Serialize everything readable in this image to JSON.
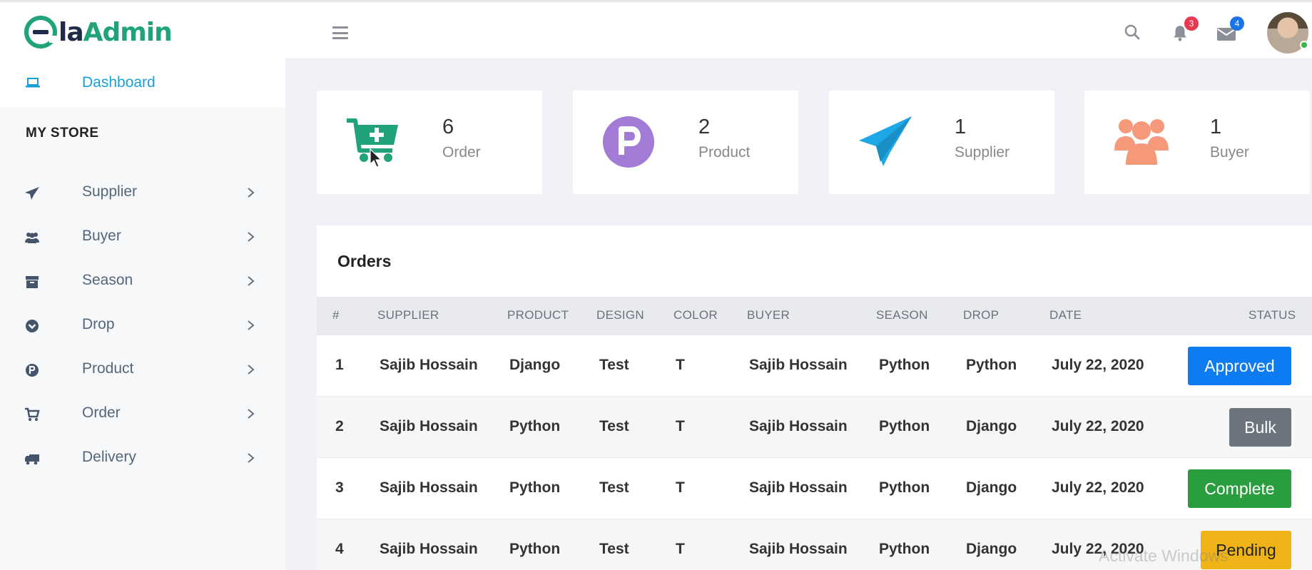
{
  "brand": {
    "e": "e",
    "la": "la",
    "admin": "Admin"
  },
  "header": {
    "notifications_count": "3",
    "messages_count": "4",
    "icons": [
      "menu-icon",
      "search-icon",
      "bell-icon",
      "mail-icon"
    ]
  },
  "sidebar": {
    "dashboard": {
      "label": "Dashboard",
      "icon": "laptop-icon"
    },
    "section_title": "MY STORE",
    "items": [
      {
        "label": "Supplier",
        "icon": "paper-plane-icon"
      },
      {
        "label": "Buyer",
        "icon": "users-icon"
      },
      {
        "label": "Season",
        "icon": "archive-icon"
      },
      {
        "label": "Drop",
        "icon": "chevron-circle-down-icon"
      },
      {
        "label": "Product",
        "icon": "product-p-icon"
      },
      {
        "label": "Order",
        "icon": "cart-icon"
      },
      {
        "label": "Delivery",
        "icon": "truck-icon"
      }
    ]
  },
  "stats": [
    {
      "value": "6",
      "label": "Order",
      "icon": "cart-plus-icon",
      "color": "#20a37a"
    },
    {
      "value": "2",
      "label": "Product",
      "icon": "product-p-icon",
      "color": "#a27bd6"
    },
    {
      "value": "1",
      "label": "Supplier",
      "icon": "paper-plane-icon",
      "color": "#1ea7e6"
    },
    {
      "value": "1",
      "label": "Buyer",
      "icon": "users-icon",
      "color": "#f5997a"
    }
  ],
  "orders": {
    "title": "Orders",
    "columns": [
      "#",
      "SUPPLIER",
      "PRODUCT",
      "DESIGN",
      "COLOR",
      "BUYER",
      "SEASON",
      "DROP",
      "DATE",
      "STATUS"
    ],
    "rows": [
      {
        "num": "1",
        "supplier": "Sajib Hossain",
        "product": "Django",
        "design": "Test",
        "color": "T",
        "buyer": "Sajib Hossain",
        "season": "Python",
        "drop": "Python",
        "date": "July 22, 2020",
        "status": "Approved",
        "status_color": "#0d7cf2"
      },
      {
        "num": "2",
        "supplier": "Sajib Hossain",
        "product": "Python",
        "design": "Test",
        "color": "T",
        "buyer": "Sajib Hossain",
        "season": "Python",
        "drop": "Django",
        "date": "July 22, 2020",
        "status": "Bulk",
        "status_color": "#6c757d"
      },
      {
        "num": "3",
        "supplier": "Sajib Hossain",
        "product": "Python",
        "design": "Test",
        "color": "T",
        "buyer": "Sajib Hossain",
        "season": "Python",
        "drop": "Django",
        "date": "July 22, 2020",
        "status": "Complete",
        "status_color": "#2a9d3f"
      },
      {
        "num": "4",
        "supplier": "Sajib Hossain",
        "product": "Python",
        "design": "Test",
        "color": "T",
        "buyer": "Sajib Hossain",
        "season": "Python",
        "drop": "Django",
        "date": "July 22, 2020",
        "status": "Pending",
        "status_color": "#f0b418"
      }
    ]
  },
  "watermark": "Activate Windows"
}
